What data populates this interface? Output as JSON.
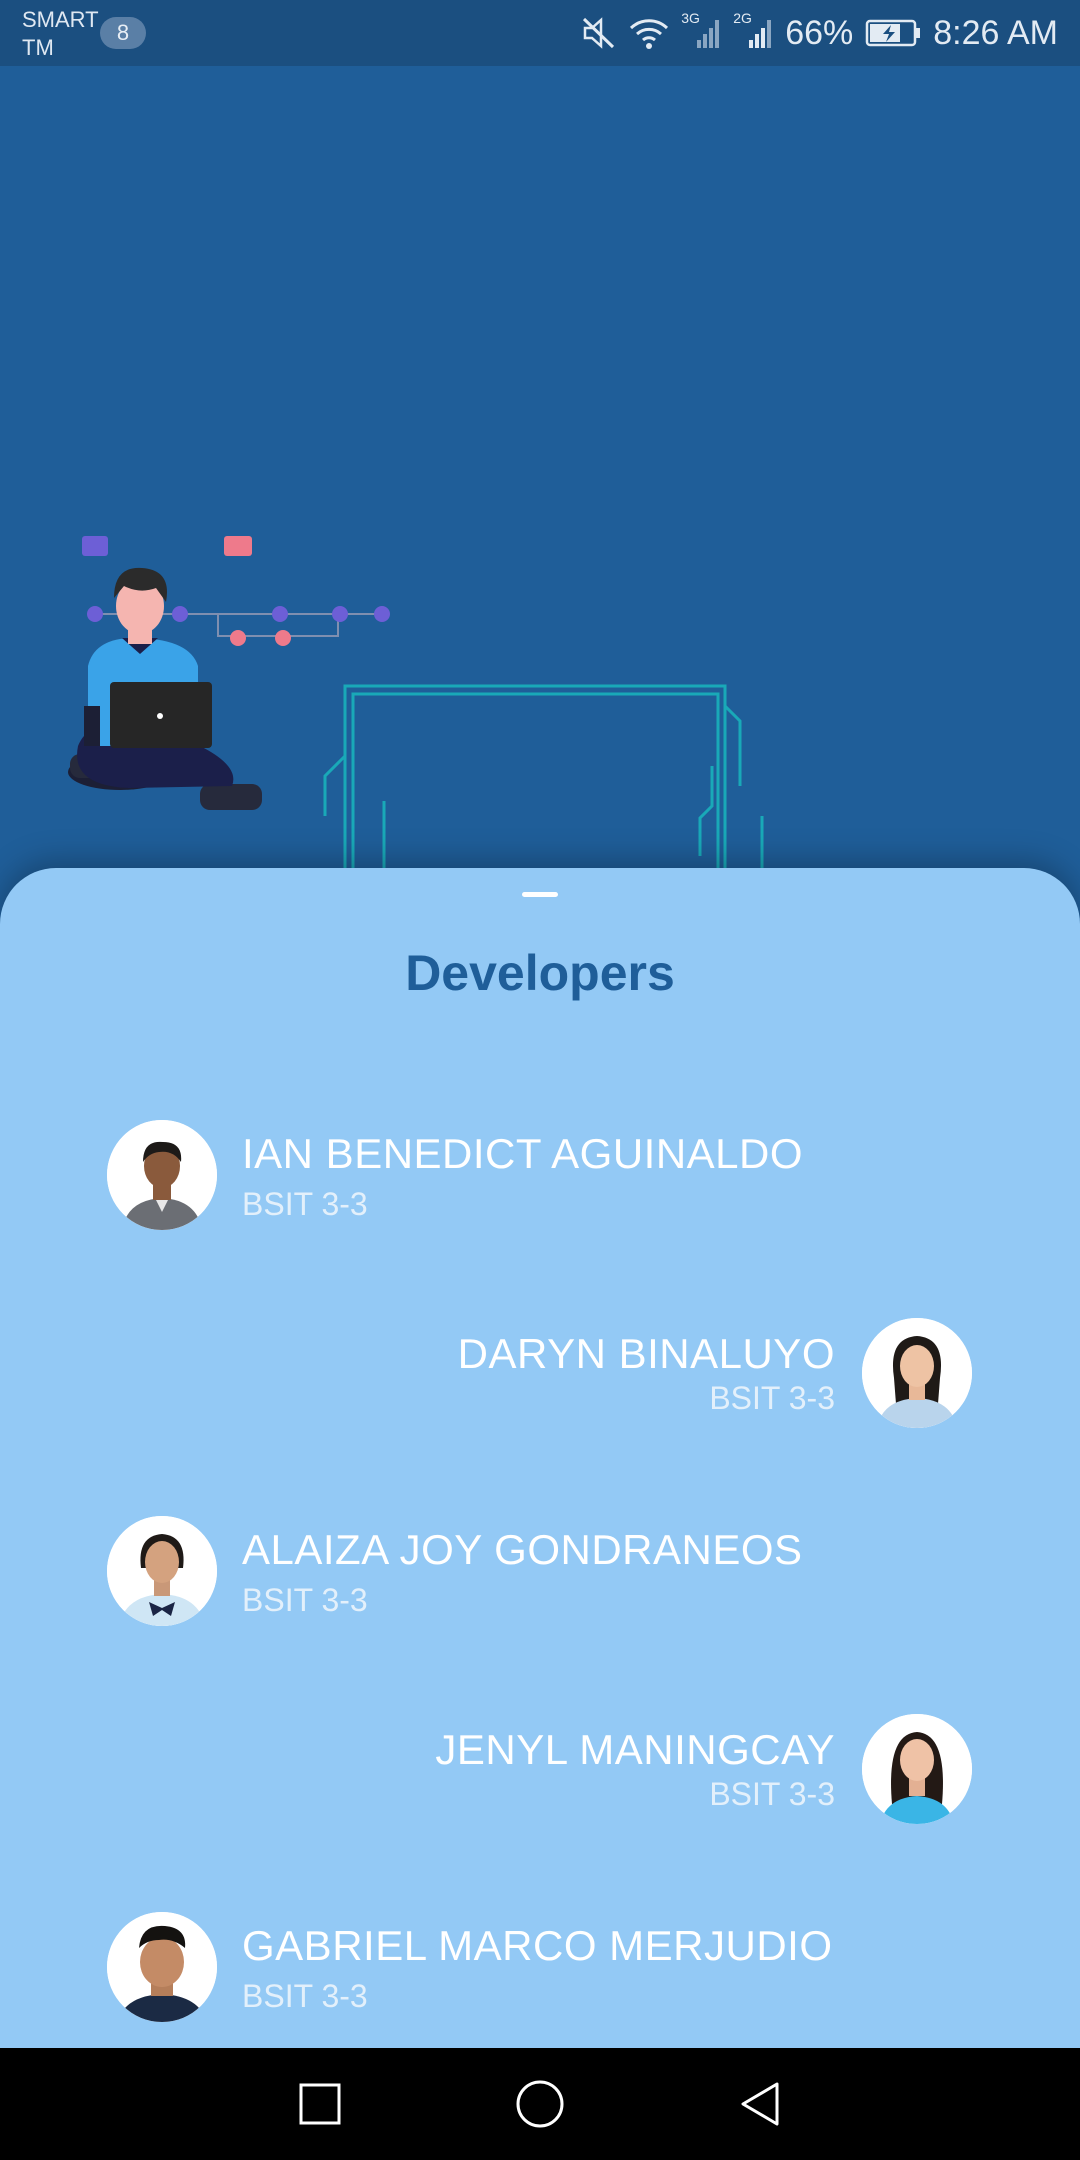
{
  "status_bar": {
    "carrier_line1": "SMART",
    "carrier_line2": "TM",
    "sim_badge": "8",
    "network_3g": "3G",
    "network_2g": "2G",
    "battery_percent": "66%",
    "time": "8:26 AM",
    "icons": [
      "mute-icon",
      "wifi-icon",
      "signal-3g-icon",
      "signal-2g-icon",
      "battery-charging-icon"
    ]
  },
  "hero": {
    "illustration": "developer-with-laptop-circuit-illustration"
  },
  "sheet": {
    "title": "Developers",
    "developers": [
      {
        "name": "IAN BENEDICT AGUINALDO",
        "course": "BSIT 3-3",
        "align": "left"
      },
      {
        "name": "DARYN BINALUYO",
        "course": "BSIT 3-3",
        "align": "right"
      },
      {
        "name": "ALAIZA JOY GONDRANEOS",
        "course": "BSIT 3-3",
        "align": "left"
      },
      {
        "name": "JENYL MANINGCAY",
        "course": "BSIT 3-3",
        "align": "right"
      },
      {
        "name": "GABRIEL MARCO MERJUDIO",
        "course": "BSIT 3-3",
        "align": "left"
      }
    ]
  },
  "nav_bar": {
    "buttons": [
      "recents-square-icon",
      "home-circle-icon",
      "back-triangle-icon"
    ]
  },
  "colors": {
    "hero_bg": "#1f5e99",
    "status_bg": "#1b4f80",
    "sheet_bg": "#93c9f5",
    "title": "#1f5e99",
    "circuit": "#19a9b8"
  }
}
